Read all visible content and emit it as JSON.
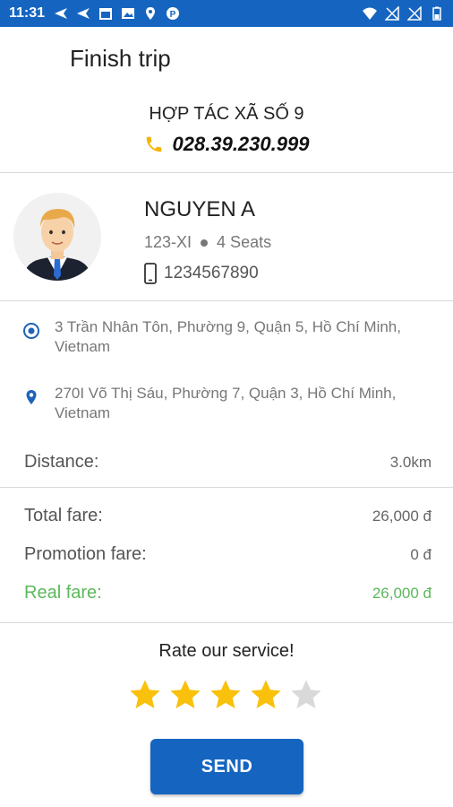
{
  "status_bar": {
    "time": "11:31",
    "icons": [
      "navigation-icon",
      "navigation-icon",
      "calendar-app-icon",
      "image-icon",
      "location-pin-icon",
      "parking-icon",
      "wifi-icon",
      "no-signal-icon",
      "no-signal-icon",
      "battery-icon"
    ]
  },
  "header": {
    "title": "Finish trip"
  },
  "company": {
    "name": "HỢP TÁC XÃ SỐ 9",
    "phone": "028.39.230.999",
    "phone_icon_color": "#f4b400"
  },
  "driver": {
    "name": "NGUYEN A",
    "plate": "123-XI",
    "seats": "4 Seats",
    "phone": "1234567890"
  },
  "trip": {
    "pickup": "3 Trần Nhân Tôn, Phường 9, Quận 5, Hồ Chí Minh, Vietnam",
    "dropoff": "270I Võ Thị Sáu, Phường 7, Quận 3, Hồ Chí Minh, Vietnam",
    "distance_label": "Distance:",
    "distance_value": "3.0km"
  },
  "fare": {
    "total_label": "Total fare:",
    "total_value": "26,000 đ",
    "promotion_label": "Promotion fare:",
    "promotion_value": "0 đ",
    "real_label": "Real fare:",
    "real_value": "26,000 đ",
    "real_color": "#5cb85c"
  },
  "rating": {
    "prompt": "Rate our service!",
    "value": 4,
    "max": 5,
    "filled_color": "#f9c10b",
    "empty_color": "#d9d9d9"
  },
  "actions": {
    "send_label": "SEND"
  },
  "colors": {
    "primary": "#1565c0"
  }
}
